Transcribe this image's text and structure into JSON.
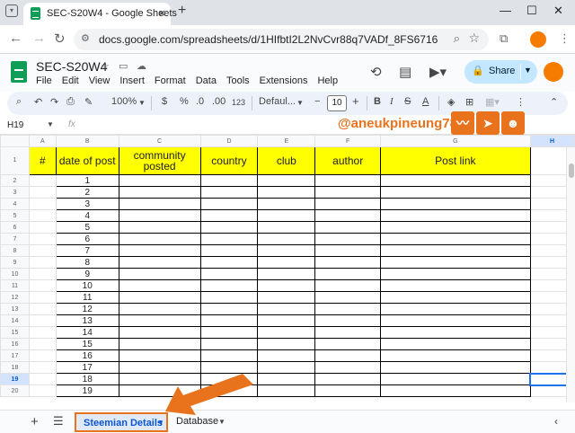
{
  "browser": {
    "tab_title": "SEC-S20W4 - Google Sheets",
    "url": "docs.google.com/spreadsheets/d/1HIfbtI2L2NvCvr88q7VADf_8FS67163n1arxvB47g7g..."
  },
  "app": {
    "doc_title": "SEC-S20W4",
    "menus": [
      "File",
      "Edit",
      "View",
      "Insert",
      "Format",
      "Data",
      "Tools",
      "Extensions",
      "Help"
    ],
    "share_label": "Share"
  },
  "toolbar": {
    "zoom": "100%",
    "currency": "$",
    "percent": "%",
    "dec_down": ".0",
    "dec_up": ".00",
    "num_format": "123",
    "font": "Defaul...",
    "font_size": "10",
    "minus": "−",
    "plus": "+"
  },
  "formula_bar": {
    "name_box": "H19",
    "fx": "fx"
  },
  "watermark": {
    "handle": "@aneukpineung78"
  },
  "sheet": {
    "columns": [
      "A",
      "B",
      "C",
      "D",
      "E",
      "F",
      "G",
      "H"
    ],
    "header": [
      "#",
      "date of post",
      "community posted",
      "country",
      "club",
      "author",
      "Post link"
    ],
    "row_labels": [
      "1",
      "2",
      "3",
      "4",
      "5",
      "6",
      "7",
      "8",
      "9",
      "10",
      "11",
      "12",
      "13",
      "14",
      "15",
      "16",
      "17",
      "18",
      "19",
      "20"
    ],
    "numbers": [
      "1",
      "2",
      "3",
      "4",
      "5",
      "6",
      "7",
      "8",
      "9",
      "10",
      "11",
      "12",
      "13",
      "14",
      "15",
      "16",
      "17",
      "18",
      "19"
    ]
  },
  "sheet_tabs": [
    {
      "label": "Steemian Details",
      "active": true
    },
    {
      "label": "Database",
      "active": false
    }
  ],
  "colors": {
    "header_fill": "#ffff00",
    "accent_orange": "#e8731c",
    "sheets_green": "#0f9d58"
  }
}
